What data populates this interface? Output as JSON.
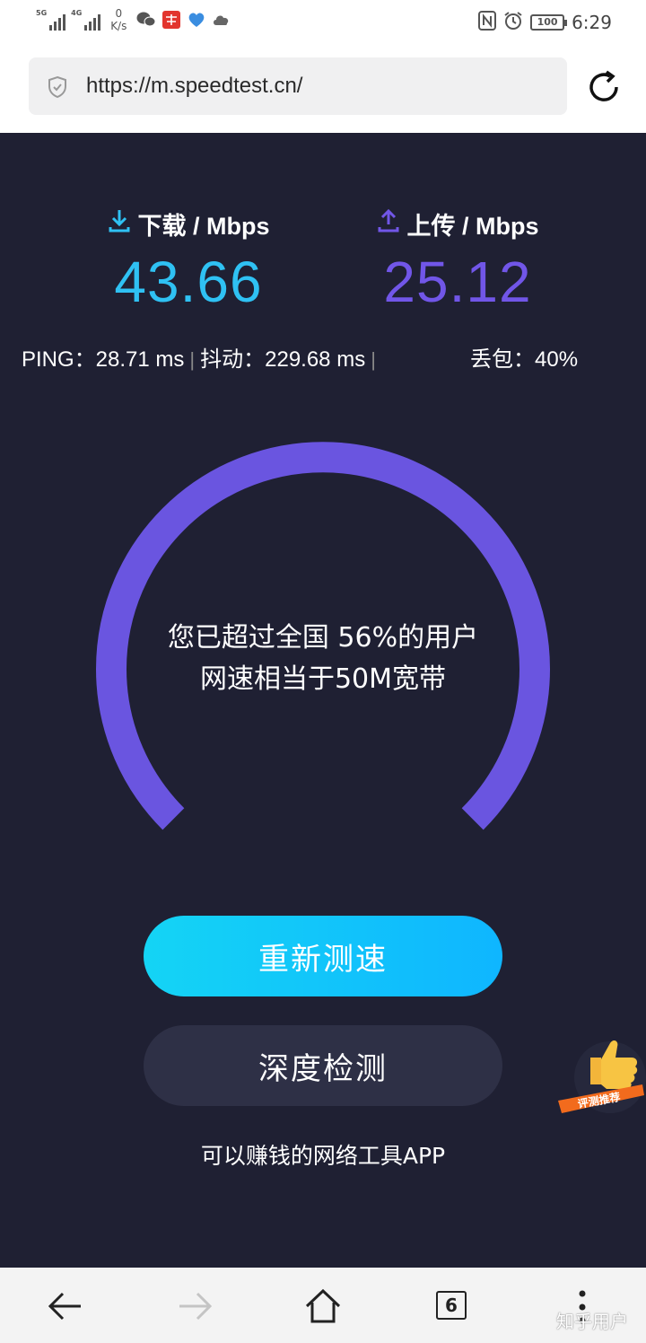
{
  "status_bar": {
    "signal1_tag": "5G",
    "signal2_tag": "4G",
    "net_speed_value": "0",
    "net_speed_unit": "K/s",
    "battery": "100",
    "time": "6:29"
  },
  "browser": {
    "url": "https://m.speedtest.cn/"
  },
  "download": {
    "label": "下载 / Mbps",
    "value": "43.66",
    "color": "#2fc1f3"
  },
  "upload": {
    "label": "上传 / Mbps",
    "value": "25.12",
    "color": "#7156e8"
  },
  "stats": {
    "ping": "PING：28.71 ms",
    "jitter": "抖动：229.68 ms",
    "loss": "丢包：40%"
  },
  "gauge": {
    "line1": "您已超过全国 56%的用户",
    "line2": "网速相当于50M宽带",
    "color": "#6a55e0"
  },
  "buttons": {
    "retest": "重新测速",
    "deep_check": "深度检测"
  },
  "tagline": "可以赚钱的网络工具APP",
  "badge": {
    "label": "评测推荐"
  },
  "bottom_nav": {
    "tab_count": "6",
    "watermark": "知乎用户"
  }
}
